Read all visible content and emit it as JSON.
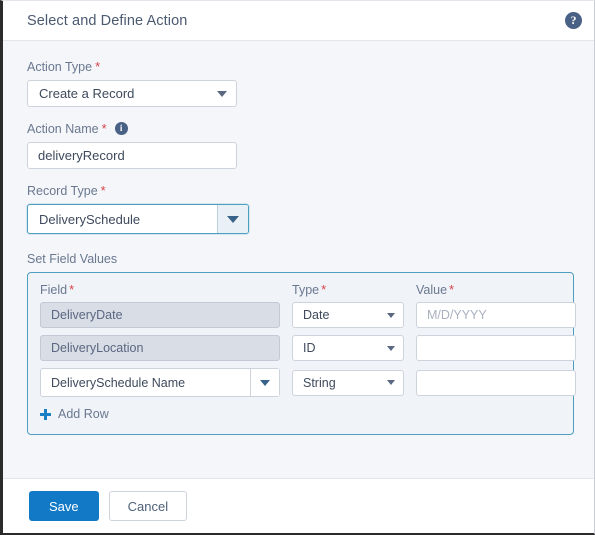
{
  "dialog": {
    "title": "Select and Define Action",
    "help_icon": "help-circle-icon",
    "help_glyph": "?"
  },
  "colors": {
    "accent_blue": "#1279c6",
    "focus_border": "#4e9ec0",
    "required_red": "#d8434a",
    "label_gray": "#6a7890",
    "panel_bg": "#f0f3f8",
    "body_bg": "#f4f6f9"
  },
  "form": {
    "action_type": {
      "label": "Action Type",
      "required_marker": "*",
      "value": "Create a Record"
    },
    "action_name": {
      "label": "Action Name",
      "required_marker": "*",
      "info_glyph": "i",
      "value": "deliveryRecord",
      "placeholder": ""
    },
    "record_type": {
      "label": "Record Type",
      "required_marker": "*",
      "value": "DeliverySchedule"
    }
  },
  "set_field_values": {
    "section_label": "Set Field Values",
    "columns": [
      {
        "label": "Field",
        "required_marker": "*"
      },
      {
        "label": "Type",
        "required_marker": "*"
      },
      {
        "label": "Value",
        "required_marker": "*"
      }
    ],
    "rows": [
      {
        "field": "DeliveryDate",
        "field_kind": "readonly",
        "type": "Date",
        "value": "",
        "value_placeholder": "M/D/YYYY",
        "deletable": false
      },
      {
        "field": "DeliveryLocation",
        "field_kind": "readonly",
        "type": "ID",
        "value": "",
        "value_placeholder": "",
        "deletable": false
      },
      {
        "field": "DeliverySchedule Name",
        "field_kind": "select",
        "type": "String",
        "value": "",
        "value_placeholder": "",
        "deletable": true,
        "delete_glyph": "×"
      }
    ],
    "add_row_label": "Add Row"
  },
  "footer": {
    "save_label": "Save",
    "cancel_label": "Cancel"
  }
}
